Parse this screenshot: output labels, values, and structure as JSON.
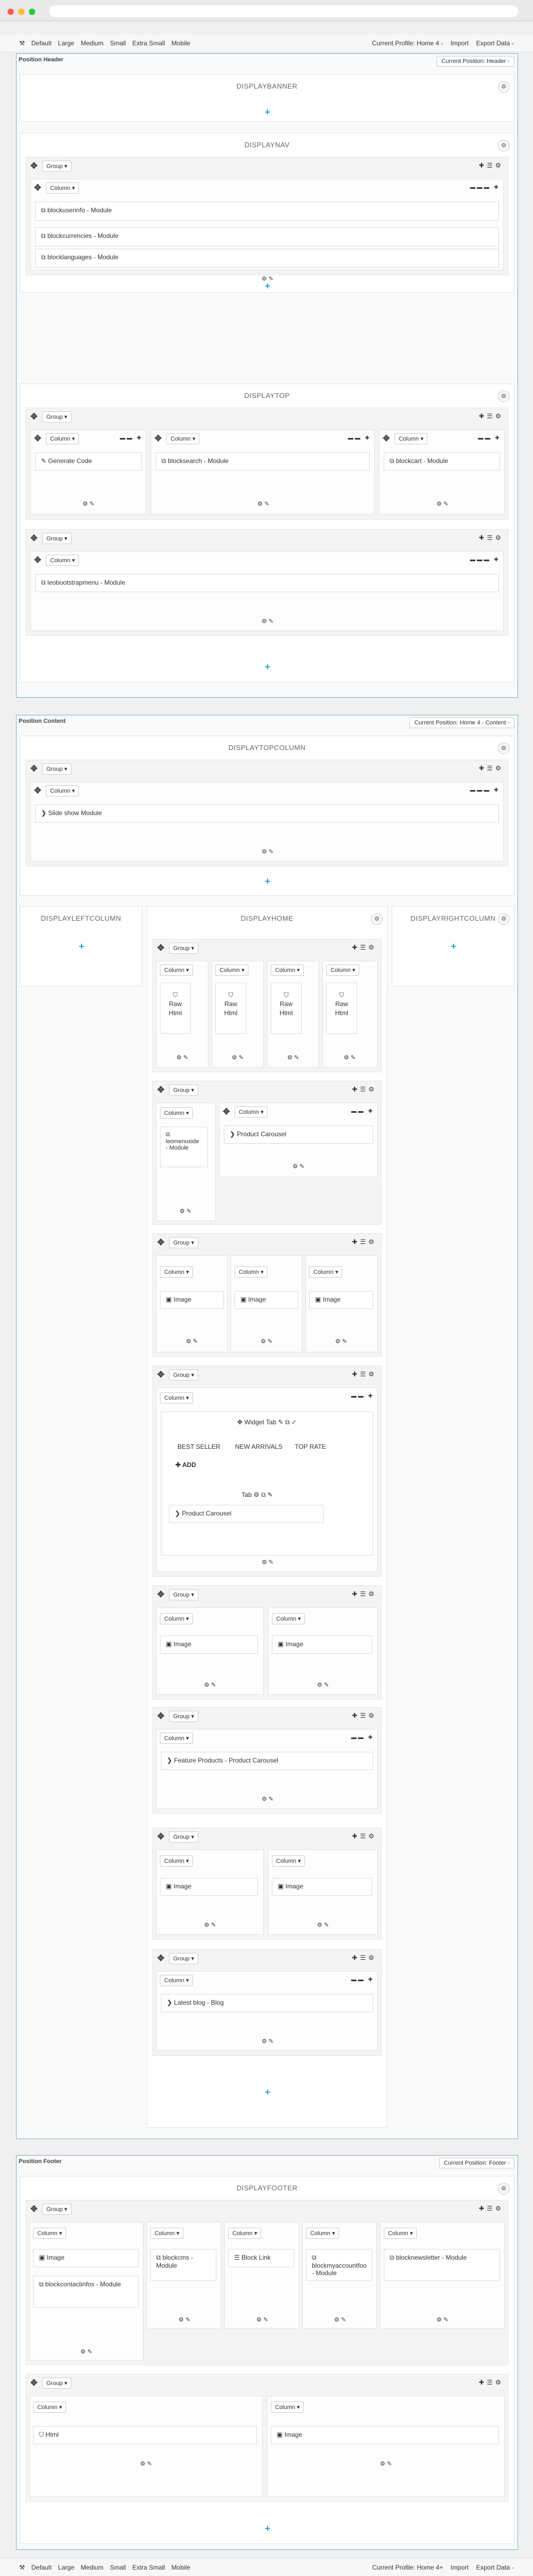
{
  "toolbar": {
    "devices": [
      "Default",
      "Large",
      "Medium",
      "Small",
      "Extra Small",
      "Mobile"
    ],
    "profile": "Current Profile: Home 4 -",
    "import": "Import",
    "export": "Export Data -"
  },
  "bottom_toolbar": {
    "profile": "Current Profile: Home 4+"
  },
  "header": {
    "title": "Position Header",
    "current": "Current Position: Header -"
  },
  "content": {
    "title": "Position Content",
    "current": "Current Position: Home 4 - Content -"
  },
  "footer": {
    "title": "Position Footer",
    "current": "Current Position: Footer -"
  },
  "hooks": {
    "banner": "DISPLAYBANNER",
    "nav": "DISPLAYNAV",
    "top": "DISPLAYTOP",
    "topcolumn": "DISPLAYTOPCOLUMN",
    "leftcolumn": "DISPLAYLEFTCOLUMN",
    "home": "DISPLAYHOME",
    "rightcolumn": "DISPLAYRIGHTCOLUMN",
    "footer": "DISPLAYFOOTER"
  },
  "labels": {
    "group": "Group",
    "column": "Column",
    "plus": "+",
    "gear": "⚙",
    "move": "✥"
  },
  "modules": {
    "nav": [
      "blockuserinfo - Module",
      "blockcurrencies - Module",
      "blocklanguages - Module"
    ],
    "top": [
      "Generate Code",
      "blocksearch - Module",
      "blockcart - Module"
    ],
    "topmenu": "leobootstrapmenu - Module",
    "slideshow": "Slide show Module",
    "raw": "Raw Html",
    "leomenuside": "leomenuside - Module",
    "product_carousel": "Product Carousel",
    "image": "Image",
    "widget_tab": "Widget Tab",
    "tabs": [
      "BEST SELLER",
      "NEW ARRIVALS",
      "TOP RATE"
    ],
    "add": "ADD",
    "tab": "Tab",
    "feature": "Feature Products - Product Carousel",
    "latest_blog": "Latest blog - Blog",
    "contactinfos": "blockcontactinfos - Module",
    "blockcms": "blockcms - Module",
    "blocklink": "Block Link",
    "myaccount": "blockmyaccountfoo - Module",
    "newsletter": "blocknewsletter - Module",
    "html": "Html"
  },
  "colors": {
    "accent": "#2aa3d1",
    "border": "#6fb0d4"
  }
}
